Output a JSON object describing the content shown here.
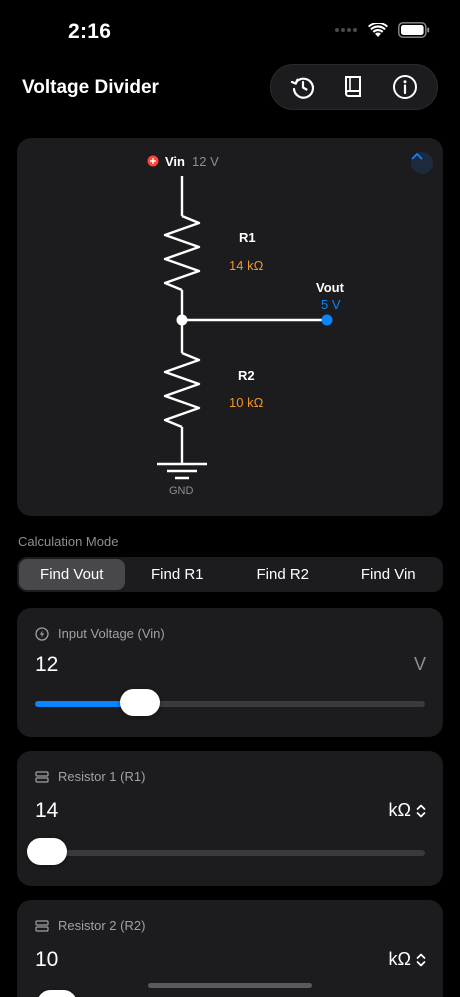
{
  "status_bar": {
    "time": "2:16"
  },
  "nav": {
    "title": "Voltage Divider",
    "icons": [
      "history-icon",
      "book-icon",
      "info-icon"
    ]
  },
  "diagram": {
    "vin_label": "Vin",
    "vin_value": "12 V",
    "r1_label": "R1",
    "r1_value": "14 kΩ",
    "vout_label": "Vout",
    "vout_value": "5 V",
    "r2_label": "R2",
    "r2_value": "10 kΩ",
    "gnd_label": "GND",
    "colors": {
      "resistor_value": "#f0952c",
      "vout_value": "#0a84ff",
      "vin_dot": "#ff453a"
    }
  },
  "mode": {
    "label": "Calculation Mode",
    "options": [
      "Find Vout",
      "Find R1",
      "Find R2",
      "Find Vin"
    ],
    "selected": "Find Vout"
  },
  "inputs": {
    "vin": {
      "label": "Input Voltage (Vin)",
      "value": "12",
      "unit": "V",
      "slider_fraction": 0.27
    },
    "r1": {
      "label": "Resistor 1 (R1)",
      "value": "14",
      "unit": "kΩ",
      "slider_fraction": 0.03
    },
    "r2": {
      "label": "Resistor 2 (R2)",
      "value": "10",
      "unit": "kΩ"
    }
  },
  "accent": "#0a84ff"
}
